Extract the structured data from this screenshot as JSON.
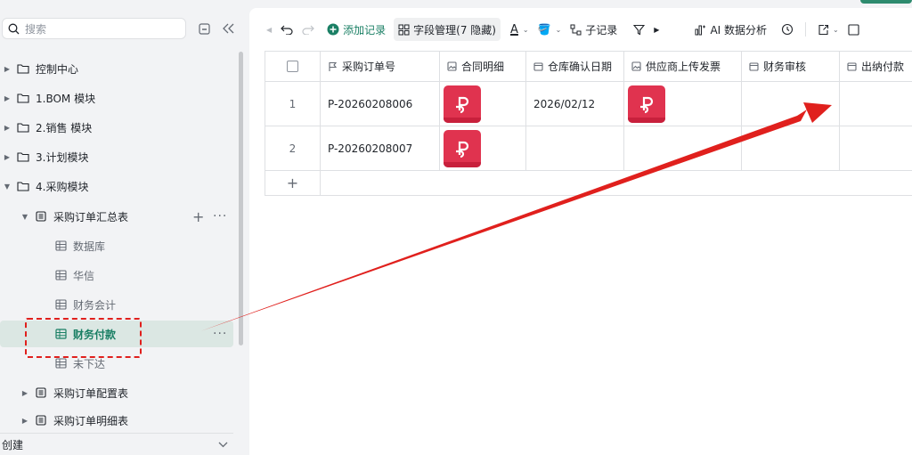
{
  "sidebar": {
    "search_placeholder": "搜索",
    "items": [
      {
        "label": "控制中心"
      },
      {
        "label": "1.BOM 模块"
      },
      {
        "label": "2.销售 模块"
      },
      {
        "label": "3.计划模块"
      },
      {
        "label": "4.采购模块"
      },
      {
        "label": "采购订单汇总表"
      },
      {
        "label": "数据库"
      },
      {
        "label": "华信"
      },
      {
        "label": "财务会计"
      },
      {
        "label": "财务付款"
      },
      {
        "label": "未下达"
      },
      {
        "label": "采购订单配置表"
      },
      {
        "label": "采购订单明细表"
      }
    ],
    "footer_label": "创建"
  },
  "toolbar": {
    "add_record": "添加记录",
    "field_manage": "字段管理(7 隐藏)",
    "sub_record": "子记录",
    "ai_analysis": "AI 数据分析"
  },
  "table": {
    "columns": [
      "采购订单号",
      "合同明细",
      "仓库确认日期",
      "供应商上传发票",
      "财务审核",
      "出纳付款"
    ],
    "rows": [
      {
        "num": "1",
        "order": "P-20260208006",
        "date": "2026/02/12"
      },
      {
        "num": "2",
        "order": "P-20260208007",
        "date": ""
      }
    ]
  },
  "colors": {
    "accent": "#2e8b6e",
    "annotation": "#e0201d",
    "pdf": "#e0334f"
  }
}
